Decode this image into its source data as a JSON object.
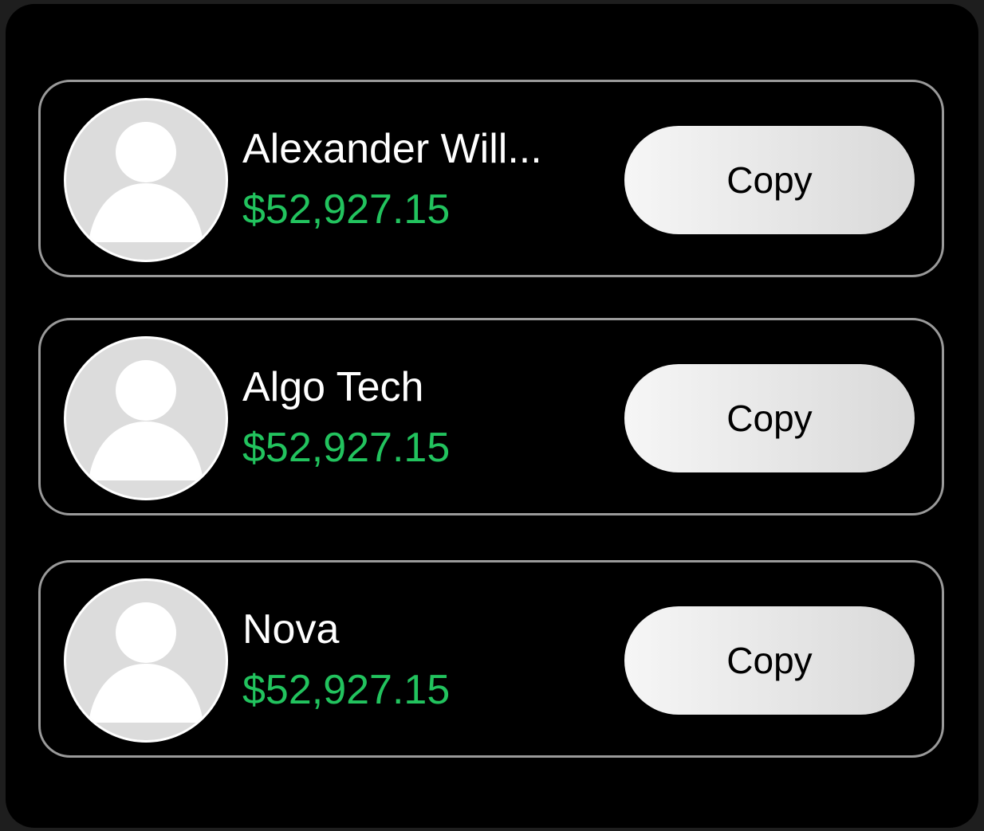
{
  "traders": [
    {
      "name": "Alexander Will...",
      "amount": "$52,927.15",
      "button_label": "Copy"
    },
    {
      "name": "Algo Tech",
      "amount": "$52,927.15",
      "button_label": "Copy"
    },
    {
      "name": "Nova",
      "amount": "$52,927.15",
      "button_label": "Copy"
    }
  ],
  "colors": {
    "background": "#000000",
    "card_border": "#9a9a9a",
    "amount": "#22c35e",
    "avatar_bg": "#dcdcdc",
    "avatar_figure": "#ffffff"
  },
  "icons": {
    "avatar": "user-placeholder-icon"
  }
}
